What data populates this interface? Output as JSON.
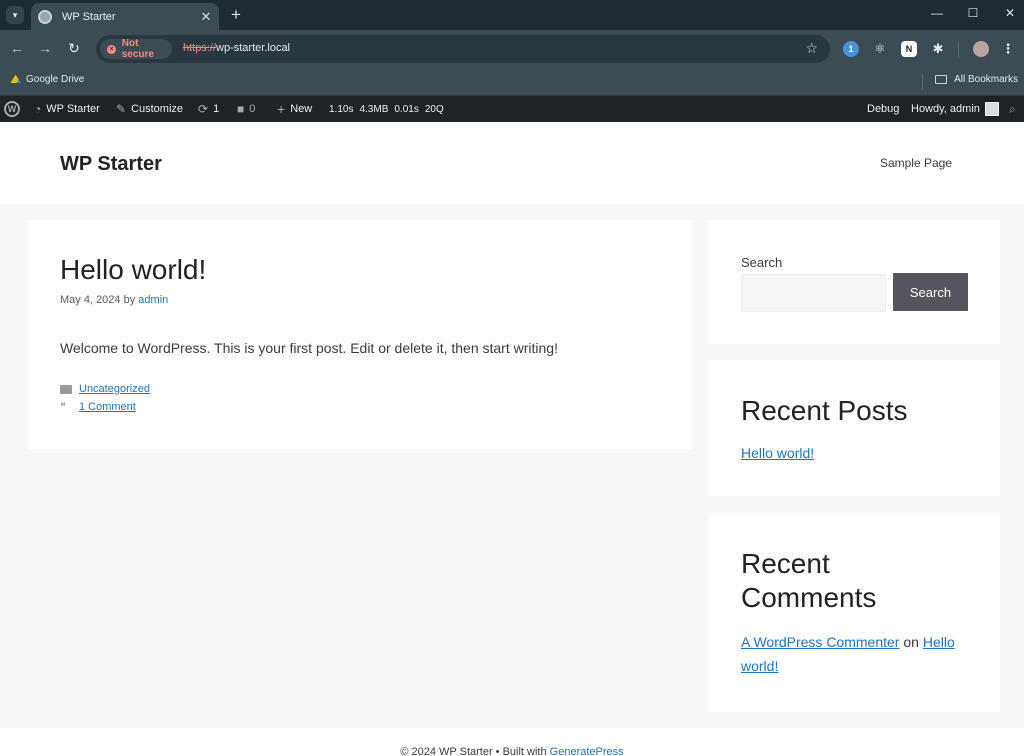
{
  "browser": {
    "tab_title": "WP Starter",
    "url_protocol": "https://",
    "url_host": "wp-starter.local",
    "security_label": "Not secure",
    "bookmarks": {
      "google_drive": "Google Drive",
      "all_bookmarks": "All Bookmarks"
    }
  },
  "adminbar": {
    "site_name": "WP Starter",
    "customize": "Customize",
    "updates_count": "1",
    "comments_count": "0",
    "new": "New",
    "perf_time": "1.10s",
    "perf_mem": "4.3MB",
    "perf_query_time": "0.01s",
    "perf_queries": "20Q",
    "debug": "Debug",
    "howdy": "Howdy, admin"
  },
  "site": {
    "title": "WP Starter",
    "menu": [
      "Sample Page"
    ]
  },
  "post": {
    "title": "Hello world!",
    "date": "May 4, 2024",
    "by": "by",
    "author": "admin",
    "content": "Welcome to WordPress. This is your first post. Edit or delete it, then start writing!",
    "category": "Uncategorized",
    "comments_link": "1 Comment"
  },
  "sidebar": {
    "search_label": "Search",
    "search_value": "",
    "search_button": "Search",
    "recent_posts_title": "Recent Posts",
    "recent_posts": [
      "Hello world!"
    ],
    "recent_comments_title_line1": "Recent",
    "recent_comments_title_line2": "Comments",
    "comment_author": "A WordPress Commenter",
    "comment_on": "on",
    "comment_post_line1": "Hello",
    "comment_post_line2": "world!"
  },
  "footer": {
    "copyright": "© 2024 WP Starter • Built with ",
    "builder": "GeneratePress"
  },
  "colors": {
    "link": "#1e73be",
    "adminbar": "#1d2327",
    "browser_chrome": "#3c4c55",
    "search_button": "#55555e"
  }
}
